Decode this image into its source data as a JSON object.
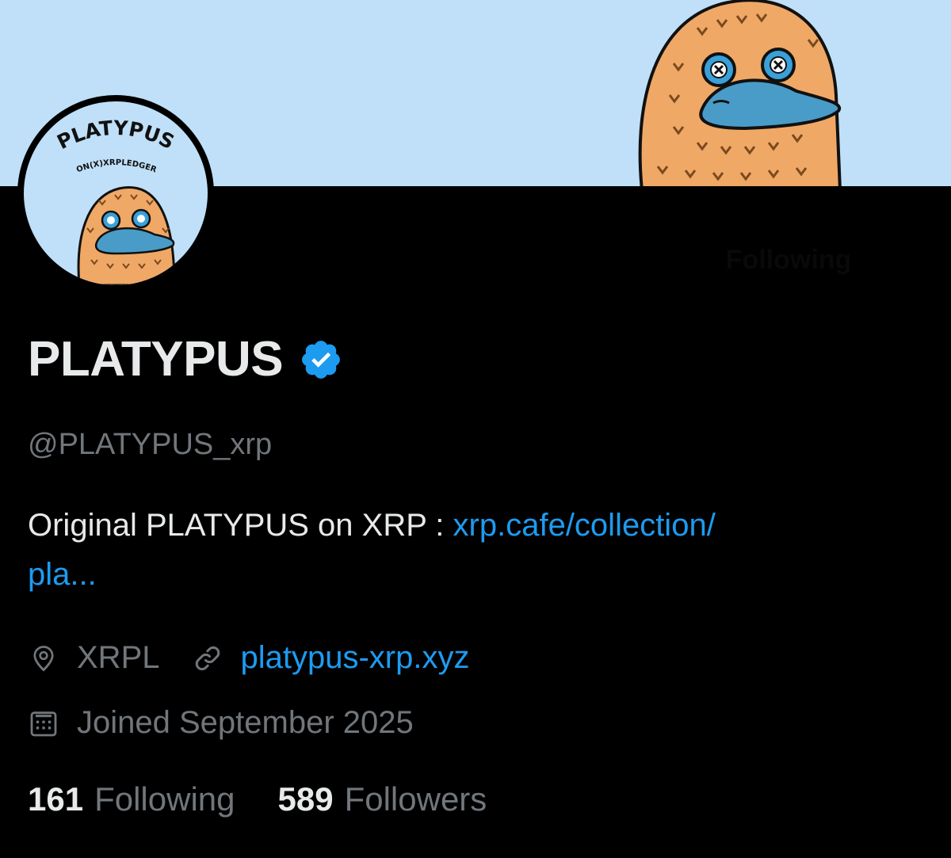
{
  "profile": {
    "avatar_text": "PLATYPUS",
    "avatar_subtext": "ON(X)XRPLEDGER",
    "display_name": "PLATYPUS",
    "verified": true,
    "handle": "@PLATYPUS_xrp",
    "bio_text": "Original PLATYPUS on XRP : ",
    "bio_link_line1": "xrp.cafe/collection/",
    "bio_link_line2": "pla...",
    "location": "XRPL",
    "website": "platypus-xrp.xyz",
    "joined": "Joined September 2025",
    "following_count": "161",
    "following_label": "Following",
    "followers_count": "589",
    "followers_label": "Followers",
    "follow_button_label": "Following"
  },
  "icons": {
    "verified": "verified-badge-icon",
    "location": "location-pin-icon",
    "website": "link-icon",
    "joined": "calendar-icon",
    "more": "more-options-icon"
  },
  "colors": {
    "background": "#000000",
    "banner": "#bfe0f8",
    "accent": "#1d9bf0",
    "primary_text": "#e7e9ea",
    "secondary_text": "#71767b"
  }
}
